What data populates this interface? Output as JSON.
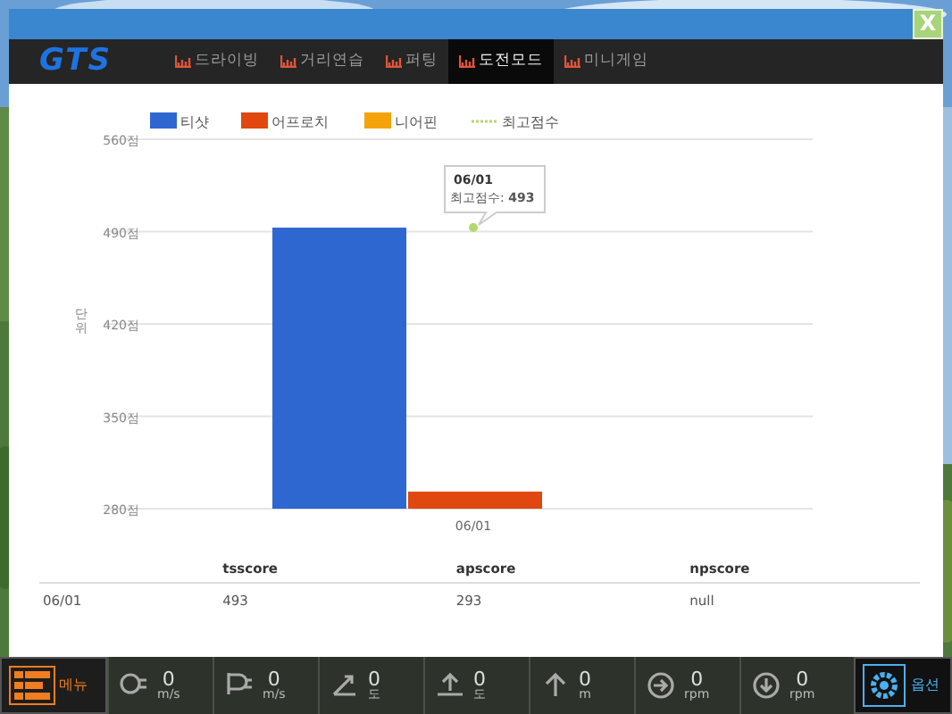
{
  "window": {
    "close_label": "X"
  },
  "nav": {
    "logo": "GTS",
    "tabs": [
      {
        "label": "드라이빙",
        "selected": false
      },
      {
        "label": "거리연습",
        "selected": false
      },
      {
        "label": "퍼팅",
        "selected": false
      },
      {
        "label": "도전모드",
        "selected": true
      },
      {
        "label": "미니게임",
        "selected": false
      }
    ]
  },
  "chart": {
    "chart_data": {
      "type": "bar",
      "grid": true,
      "legend": true,
      "ylabel": "단위",
      "categories": [
        "06/01"
      ],
      "ylim": [
        280,
        560
      ],
      "yticks": [
        {
          "value": 560,
          "label": "560점"
        },
        {
          "value": 490,
          "label": "490점"
        },
        {
          "value": 420,
          "label": "420점"
        },
        {
          "value": 350,
          "label": "350점"
        },
        {
          "value": 280,
          "label": "280점"
        }
      ],
      "series": [
        {
          "name": "티샷",
          "color": "#2f67d0",
          "values": [
            493
          ]
        },
        {
          "name": "어프로치",
          "color": "#e0480f",
          "values": [
            293
          ]
        },
        {
          "name": "니어핀",
          "color": "#f5a30a",
          "values": [
            null
          ]
        },
        {
          "name": "최고점수",
          "type": "line",
          "marker": "circle",
          "color": "#b5d86a",
          "values": [
            493
          ]
        }
      ]
    },
    "tooltip": {
      "title": "06/01",
      "text": "최고점수: **493**"
    }
  },
  "table": {
    "columns": [
      "",
      "tsscore",
      "apscore",
      "npscore"
    ],
    "rows": [
      [
        "06/01",
        "493",
        "293",
        "null"
      ]
    ]
  },
  "footer": {
    "menu_label": "메뉴",
    "gauges": [
      {
        "kind": "ball-speed",
        "value": "0",
        "unit": "m/s"
      },
      {
        "kind": "club-speed",
        "value": "0",
        "unit": "m/s"
      },
      {
        "kind": "angle",
        "value": "0",
        "unit": "도"
      },
      {
        "kind": "launch",
        "value": "0",
        "unit": "도"
      },
      {
        "kind": "height",
        "value": "0",
        "unit": "m"
      },
      {
        "kind": "spin-right",
        "value": "0",
        "unit": "rpm"
      },
      {
        "kind": "spin-down",
        "value": "0",
        "unit": "rpm"
      }
    ],
    "options_label": "옵션"
  }
}
